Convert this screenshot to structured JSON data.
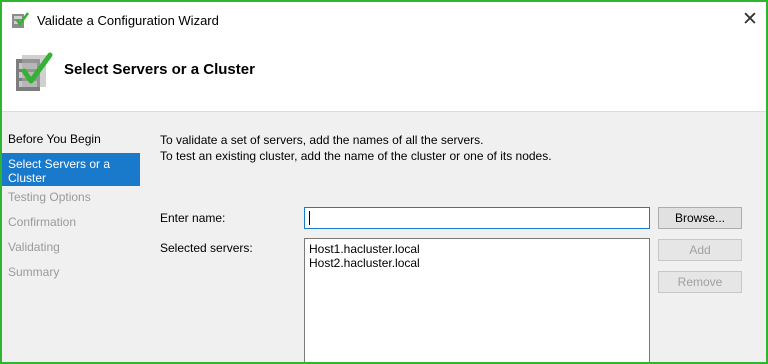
{
  "window": {
    "title": "Validate a Configuration Wizard",
    "close_glyph": "✕",
    "border_color": "#2fb52f"
  },
  "header": {
    "heading": "Select Servers or a Cluster",
    "icon": "validation-checklist-icon"
  },
  "nav": {
    "items": [
      {
        "label": "Before You Begin",
        "state": "enabled"
      },
      {
        "label": "Select Servers or a Cluster",
        "state": "active"
      },
      {
        "label": "Testing Options",
        "state": "disabled"
      },
      {
        "label": "Confirmation",
        "state": "disabled"
      },
      {
        "label": "Validating",
        "state": "disabled"
      },
      {
        "label": "Summary",
        "state": "disabled"
      }
    ]
  },
  "content": {
    "intro_line1": "To validate a set of servers, add the names of all the servers.",
    "intro_line2": "To test an existing cluster, add the name of the cluster or one of its nodes.",
    "enter_name_label": "Enter name:",
    "enter_name_value": "",
    "selected_servers_label": "Selected servers:",
    "selected_servers": [
      "Host1.hacluster.local",
      "Host2.hacluster.local"
    ]
  },
  "buttons": {
    "browse": "Browse...",
    "add": "Add",
    "remove": "Remove"
  },
  "colors": {
    "accent": "#1979ca",
    "disabled_text": "#9a9a9a"
  }
}
